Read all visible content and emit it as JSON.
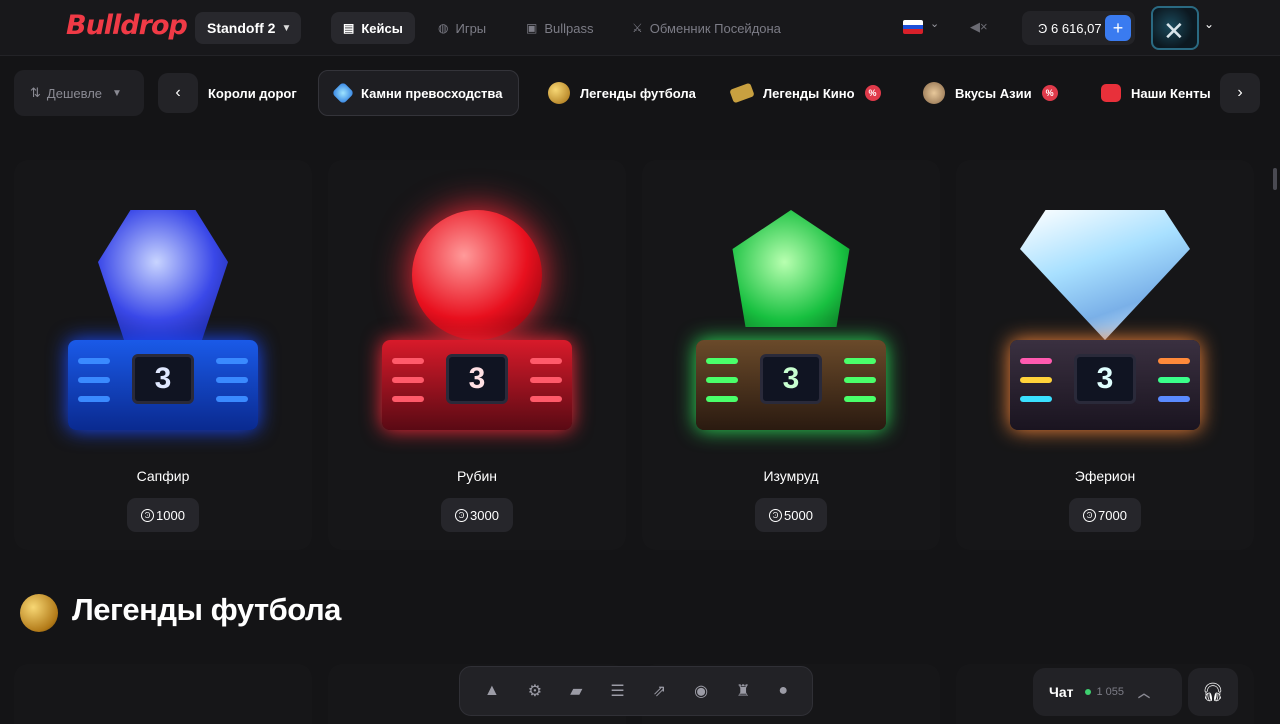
{
  "header": {
    "logo": "Bulldrop",
    "game_select": "Standoff 2",
    "nav": [
      {
        "label": "Кейсы",
        "icon": "cases-icon"
      },
      {
        "label": "Игры",
        "icon": "gamepad-icon"
      },
      {
        "label": "Bullpass",
        "icon": "ticket-icon"
      },
      {
        "label": "Обменник Посейдона",
        "icon": "trident-icon"
      }
    ],
    "balance": "Ͽ 6 616,07",
    "plus": "+"
  },
  "filters": {
    "sort_label": "Дешевле",
    "categories": [
      {
        "label": "Короли дорог",
        "icon": "road-icon"
      },
      {
        "label": "Камни превосходства",
        "icon": "diamond-icon"
      },
      {
        "label": "Легенды футбола",
        "icon": "football-icon"
      },
      {
        "label": "Легенды Кино",
        "icon": "film-icon",
        "badge": "%"
      },
      {
        "label": "Вкусы Азии",
        "icon": "food-icon",
        "badge": "%"
      },
      {
        "label": "Наши Кенты",
        "icon": "youtube-icon"
      }
    ]
  },
  "cases": [
    {
      "name": "Сапфир",
      "price": "1000",
      "color": "#2f6bff"
    },
    {
      "name": "Рубин",
      "price": "3000",
      "color": "#ff2a3a"
    },
    {
      "name": "Изумруд",
      "price": "5000",
      "color": "#2ee05a"
    },
    {
      "name": "Эферион",
      "price": "7000",
      "color": "#c8e8ff"
    }
  ],
  "section": {
    "title": "Легенды футбола"
  },
  "chat": {
    "label": "Чат",
    "online": "1 055"
  },
  "colors": {
    "accent": "#3a7bf0",
    "brand": "#f03a46",
    "bg": "#141416"
  }
}
